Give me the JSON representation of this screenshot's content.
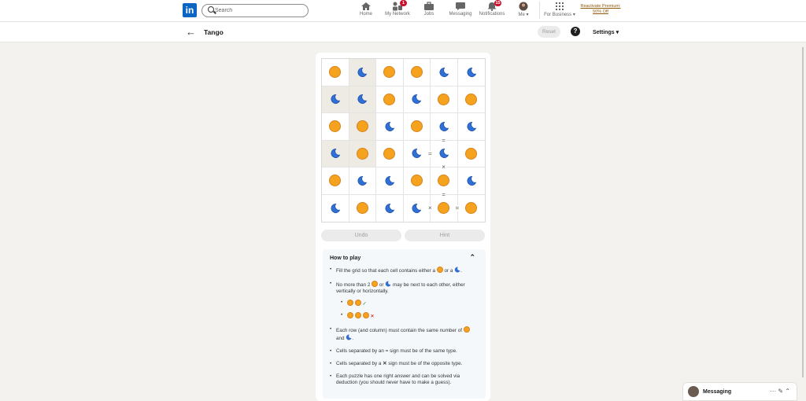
{
  "nav": {
    "logo": "in",
    "search_placeholder": "Search",
    "items": [
      {
        "label": "Home",
        "icon": "home-icon"
      },
      {
        "label": "My Network",
        "icon": "network-icon",
        "badge": "1"
      },
      {
        "label": "Jobs",
        "icon": "briefcase-icon"
      },
      {
        "label": "Messaging",
        "icon": "chat-icon"
      },
      {
        "label": "Notifications",
        "icon": "bell-icon",
        "badge": "15"
      },
      {
        "label": "Me",
        "icon": "avatar"
      },
      {
        "label": "For Business",
        "icon": "grid-icon"
      }
    ],
    "premium_line1": "Reactivate Premium:",
    "premium_line2": "50% Off"
  },
  "header": {
    "title": "Tango",
    "reset": "Reset",
    "help": "?",
    "settings": "Settings"
  },
  "game": {
    "grid": [
      [
        "sun",
        "moon",
        "sun",
        "sun",
        "moon",
        "moon"
      ],
      [
        "moon",
        "moon",
        "sun",
        "moon",
        "sun",
        "sun"
      ],
      [
        "sun",
        "sun",
        "moon",
        "sun",
        "moon",
        "moon"
      ],
      [
        "moon",
        "sun",
        "sun",
        "moon",
        "moon",
        "sun"
      ],
      [
        "sun",
        "moon",
        "moon",
        "sun",
        "sun",
        "moon"
      ],
      [
        "moon",
        "sun",
        "moon",
        "moon",
        "sun",
        "sun"
      ]
    ],
    "prefilled": [
      [
        0,
        1
      ],
      [
        1,
        0
      ],
      [
        1,
        1
      ],
      [
        2,
        1
      ],
      [
        3,
        0
      ],
      [
        3,
        1
      ]
    ],
    "constraints": [
      {
        "type": "=",
        "between": [
          [
            2,
            4
          ],
          [
            3,
            4
          ]
        ]
      },
      {
        "type": "=",
        "between": [
          [
            3,
            3
          ],
          [
            3,
            4
          ]
        ]
      },
      {
        "type": "×",
        "between": [
          [
            3,
            4
          ],
          [
            4,
            4
          ]
        ]
      },
      {
        "type": "=",
        "between": [
          [
            4,
            4
          ],
          [
            5,
            4
          ]
        ]
      },
      {
        "type": "×",
        "between": [
          [
            5,
            3
          ],
          [
            5,
            4
          ]
        ]
      },
      {
        "type": "=",
        "between": [
          [
            5,
            4
          ],
          [
            5,
            5
          ]
        ]
      }
    ],
    "colors": {
      "sun": "#f5a21e",
      "moon": "#2f6fd6"
    }
  },
  "controls": {
    "undo": "Undo",
    "hint": "Hint"
  },
  "howto": {
    "title": "How to play",
    "rule1_a": "Fill the grid so that each cell contains either a",
    "rule1_b": "or a",
    "rule2_a": "No more than 2",
    "rule2_b": "or",
    "rule2_c": "may be next to each other, either vertically or horizontally.",
    "example_ok": "✓",
    "example_bad": "✕",
    "rule3_a": "Each row (and column) must contain the same number of",
    "rule3_b": "and",
    "rule4": "Cells separated by an = sign must be of the same type.",
    "rule5_a": "Cells separated by a",
    "rule5_x": "✕",
    "rule5_b": "sign must be of the opposite type.",
    "rule6": "Each puzzle has one right answer and can be solved via deduction (you should never have to make a guess)."
  },
  "messaging": {
    "label": "Messaging",
    "actions": "··· ✎ ⌃"
  }
}
